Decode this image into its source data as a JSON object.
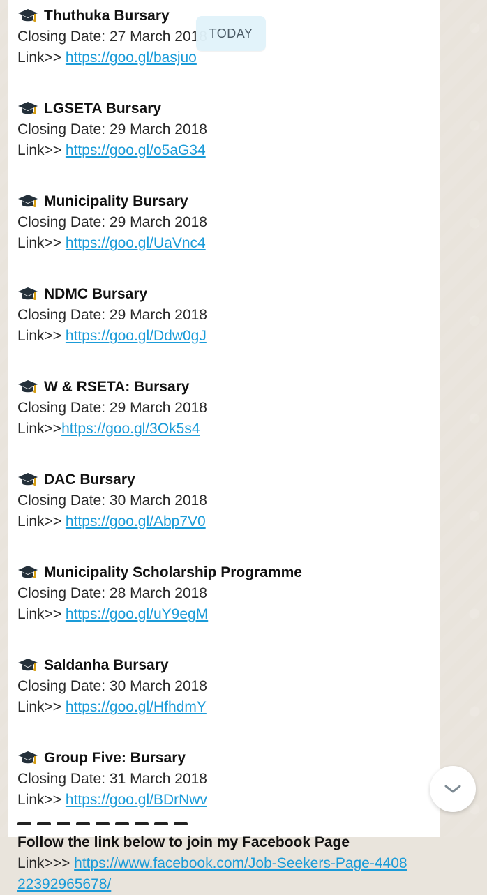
{
  "date_badge": "TODAY",
  "bursaries": [
    {
      "title": "Thuthuka Bursary",
      "closing": "Closing Date: 27 March 2018",
      "link_prefix": "Link>> ",
      "link": "https://goo.gl/basjuo"
    },
    {
      "title": "LGSETA Bursary",
      "closing": "Closing Date: 29 March 2018",
      "link_prefix": "Link>> ",
      "link": "https://goo.gl/o5aG34"
    },
    {
      "title": "Municipality Bursary",
      "closing": "Closing Date: 29 March 2018",
      "link_prefix": "Link>> ",
      "link": "https://goo.gl/UaVnc4"
    },
    {
      "title": "NDMC Bursary",
      "closing": "Closing Date: 29 March 2018",
      "link_prefix": "Link>> ",
      "link": "https://goo.gl/Ddw0gJ"
    },
    {
      "title": "W & RSETA: Bursary",
      "closing": "Closing Date: 29 March 2018",
      "link_prefix": "Link>>",
      "link": "https://goo.gl/3Ok5s4"
    },
    {
      "title": "DAC Bursary",
      "closing": "Closing Date: 30 March 2018",
      "link_prefix": "Link>> ",
      "link": "https://goo.gl/Abp7V0"
    },
    {
      "title": "Municipality Scholarship Programme",
      "closing": "Closing Date: 28 March 2018",
      "link_prefix": "Link>> ",
      "link": "https://goo.gl/uY9egM"
    },
    {
      "title": "Saldanha Bursary",
      "closing": "Closing Date: 30 March 2018",
      "link_prefix": "Link>> ",
      "link": "https://goo.gl/HfhdmY"
    },
    {
      "title": "Group Five: Bursary",
      "closing": "Closing Date: 31 March 2018",
      "link_prefix": "Link>> ",
      "link": "https://goo.gl/BDrNwv"
    }
  ],
  "footer": {
    "title": "Follow the link below to join my Facebook Page",
    "link_prefix": "Link>>> ",
    "link": "https://www.facebook.com/Job-Seekers-Page-440822392965678/"
  },
  "icons": {
    "item_icon": "graduation-cap-icon",
    "scroll_icon": "chevron-down-icon"
  }
}
